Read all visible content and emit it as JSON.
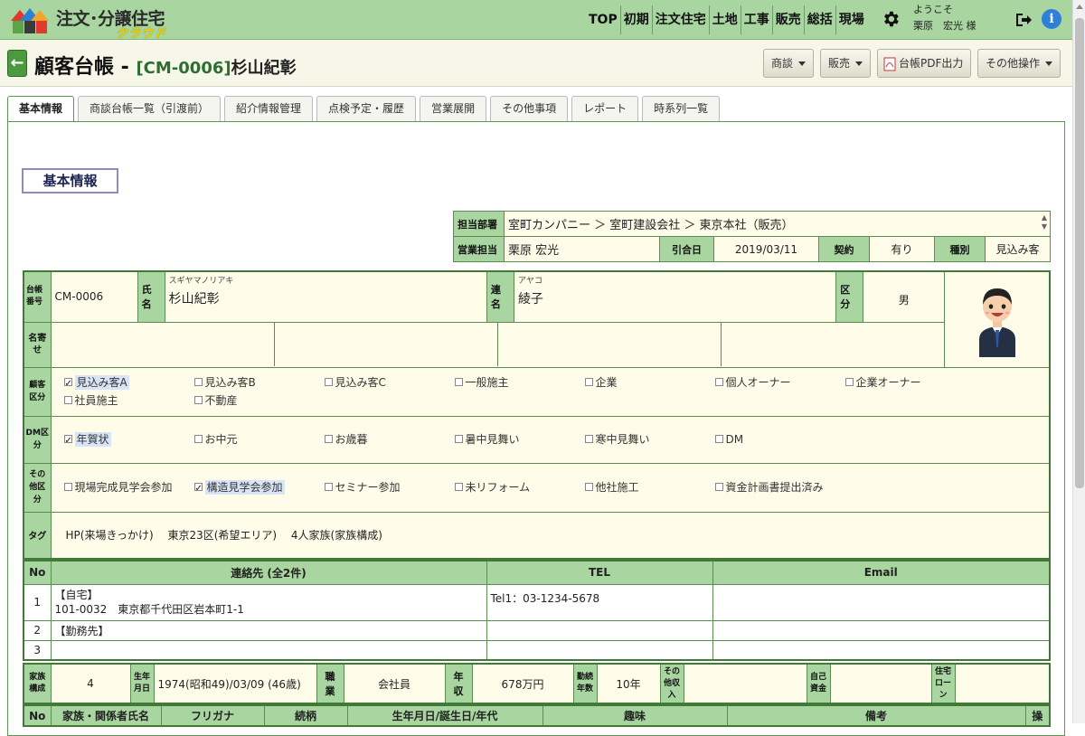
{
  "app": {
    "logo_title": "注文･分譲住宅",
    "logo_sub": "クラウド"
  },
  "nav": [
    "TOP",
    "初期",
    "注文住宅",
    "土地",
    "工事",
    "販売",
    "総括",
    "現場"
  ],
  "user": {
    "greeting": "ようこそ",
    "name": "栗原　宏光 様"
  },
  "page": {
    "title": "顧客台帳 - ",
    "code": "[CM-0006]",
    "name": "杉山紀彰"
  },
  "toolbar": {
    "negotiation": "商談",
    "sales": "販売",
    "pdf": "台帳PDF出力",
    "other": "その他操作"
  },
  "tabs": [
    "基本情報",
    "商談台帳一覧（引渡前）",
    "紹介情報管理",
    "点検予定・履歴",
    "営業展開",
    "その他事項",
    "レポート",
    "時系列一覧"
  ],
  "section_title": "基本情報",
  "assign": {
    "dept_label": "担当部署",
    "dept_value": "室町カンパニー ＞ 室町建設会社 ＞ 東京本社（販売）",
    "sales_label": "営業担当",
    "sales_value": "栗原 宏光",
    "handover_label": "引合日",
    "handover_value": "2019/03/11",
    "contract_label": "契約",
    "contract_value": "有り",
    "type_label": "種別",
    "type_value": "見込み客"
  },
  "customer": {
    "no_label": "台帳番号",
    "no_value": "CM-0006",
    "name_label": "氏名",
    "name_kana": "スギヤマノリアキ",
    "name_value": "杉山紀彰",
    "joint_label": "連名",
    "joint_kana": "アヤコ",
    "joint_value": "綾子",
    "gender_label": "区分",
    "gender_value": "男",
    "naiyose_label": "名寄せ"
  },
  "customer_type": {
    "label": "顧客区分",
    "options": [
      {
        "text": "見込み客A",
        "checked": true
      },
      {
        "text": "見込み客B",
        "checked": false
      },
      {
        "text": "見込み客C",
        "checked": false
      },
      {
        "text": "一般施主",
        "checked": false
      },
      {
        "text": "企業",
        "checked": false
      },
      {
        "text": "個人オーナー",
        "checked": false
      },
      {
        "text": "企業オーナー",
        "checked": false
      },
      {
        "text": "社員施主",
        "checked": false
      },
      {
        "text": "不動産",
        "checked": false
      }
    ]
  },
  "dm_type": {
    "label": "DM区分",
    "options": [
      {
        "text": "年賀状",
        "checked": true
      },
      {
        "text": "お中元",
        "checked": false
      },
      {
        "text": "お歳暮",
        "checked": false
      },
      {
        "text": "暑中見舞い",
        "checked": false
      },
      {
        "text": "寒中見舞い",
        "checked": false
      },
      {
        "text": "DM",
        "checked": false
      }
    ]
  },
  "other_type": {
    "label": "その他区分",
    "options": [
      {
        "text": "現場完成見学会参加",
        "checked": false
      },
      {
        "text": "構造見学会参加",
        "checked": true
      },
      {
        "text": "セミナー参加",
        "checked": false
      },
      {
        "text": "未リフォーム",
        "checked": false
      },
      {
        "text": "他社施工",
        "checked": false
      },
      {
        "text": "資金計画書提出済み",
        "checked": false
      }
    ]
  },
  "tags": {
    "label": "タグ",
    "value": "HP(来場きっかけ)　 東京23区(希望エリア)　 4人家族(家族構成)"
  },
  "contacts": {
    "h_no": "No",
    "h_contact": "連絡先 (全2件)",
    "h_tel": "TEL",
    "h_email": "Email",
    "rows": [
      {
        "no": "1",
        "line1": "【自宅】",
        "line2": "101-0032　東京都千代田区岩本町1-1",
        "tel": "Tel1：03-1234-5678",
        "email": ""
      },
      {
        "no": "2",
        "line1": "【勤務先】",
        "line2": "",
        "tel": "",
        "email": ""
      },
      {
        "no": "3",
        "line1": "",
        "line2": "",
        "tel": "",
        "email": ""
      }
    ]
  },
  "family": {
    "size_label": "家族構成",
    "size_value": "4",
    "birth_label": "生年月日",
    "birth_value": "1974(昭和49)/03/09 (46歳)",
    "job_label": "職業",
    "job_value": "会社員",
    "income_label": "年収",
    "income_value": "678万円",
    "years_label": "勤続年数",
    "years_value": "10年",
    "other_income_label": "その他収入",
    "other_income_value": "",
    "self_fund_label": "自己資金",
    "self_fund_value": "",
    "loan_label": "住宅ローン",
    "loan_value": ""
  },
  "relatives": {
    "h_no": "No",
    "h_name": "家族・関係者氏名",
    "h_kana": "フリガナ",
    "h_rel": "続柄",
    "h_birth": "生年月日/誕生日/年代",
    "h_hobby": "趣味",
    "h_note": "備考",
    "h_op": "操"
  }
}
